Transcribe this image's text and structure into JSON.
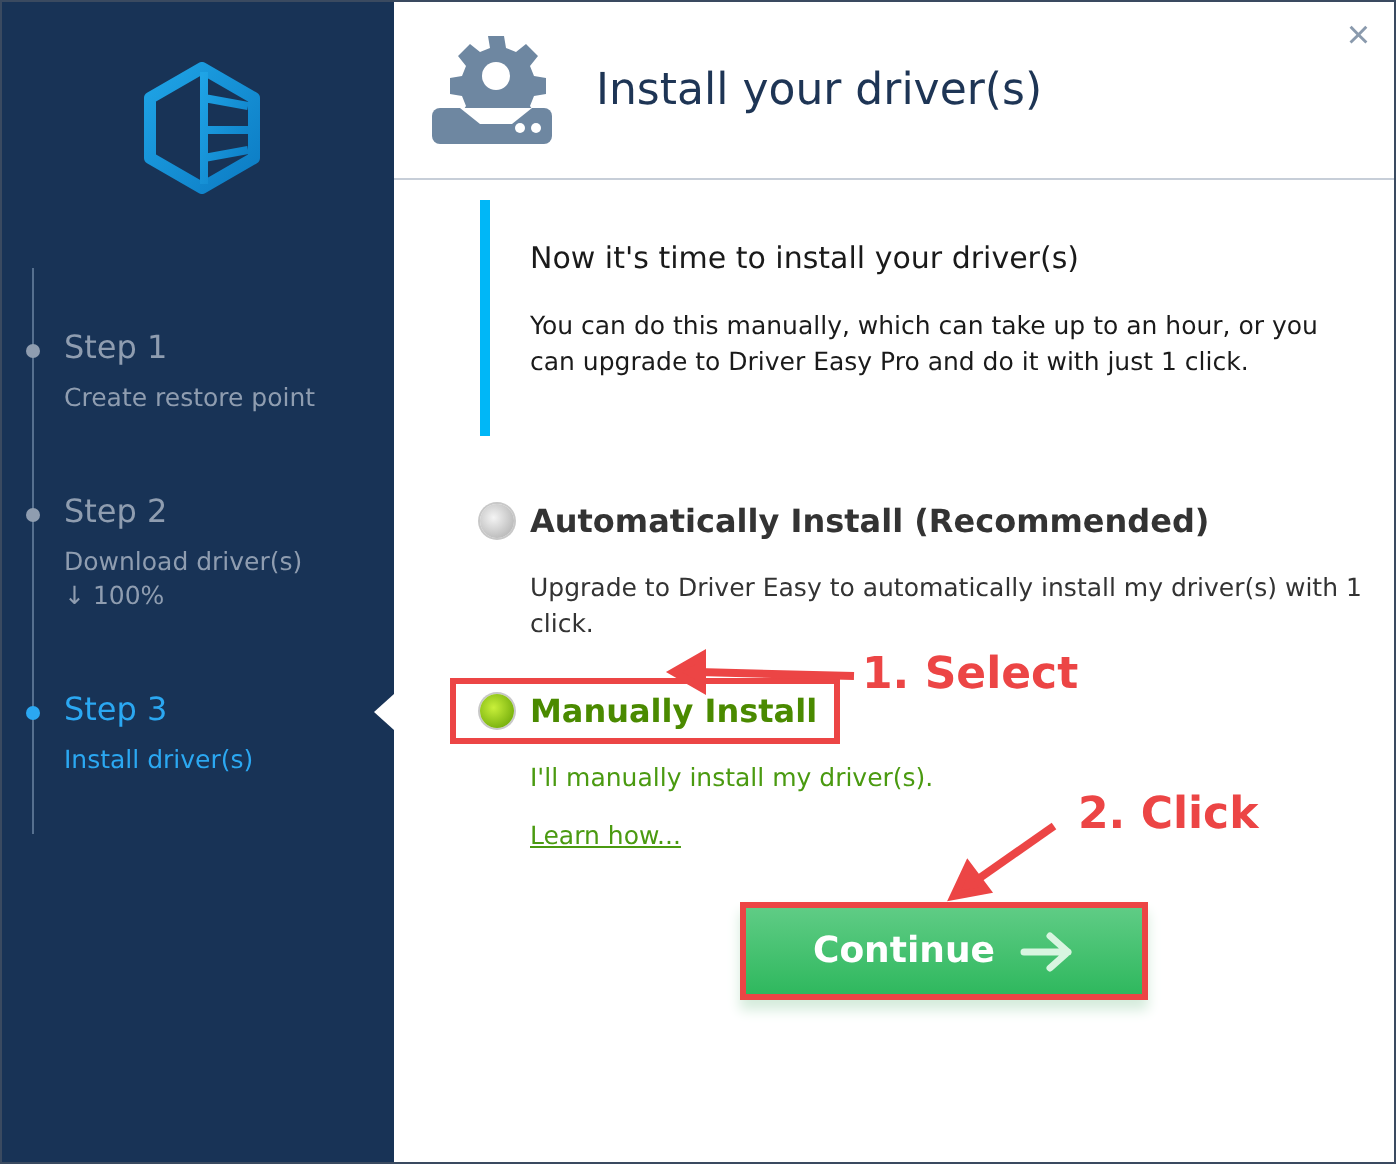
{
  "sidebar": {
    "steps": [
      {
        "title": "Step 1",
        "subtitle": "Create restore point",
        "selected": false
      },
      {
        "title": "Step 2",
        "subtitle": "Download driver(s)",
        "progress": "↓ 100%",
        "selected": false
      },
      {
        "title": "Step 3",
        "subtitle": "Install driver(s)",
        "selected": true
      }
    ]
  },
  "header": {
    "title": "Install your driver(s)",
    "close": "×"
  },
  "info": {
    "heading": "Now it's time to install your driver(s)",
    "body": "You can do this manually, which can take up to an hour, or you can upgrade to Driver Easy Pro and do it with just 1 click."
  },
  "options": [
    {
      "label": "Automatically Install (Recommended)",
      "description": "Upgrade to Driver Easy to automatically install my driver(s) with 1 click.",
      "selected": false,
      "highlighted": false
    },
    {
      "label": "Manually Install",
      "description": "I'll manually install my driver(s).",
      "link": "Learn how...",
      "selected": true,
      "highlighted": true
    }
  ],
  "continue_button": {
    "label": "Continue",
    "highlighted": true
  },
  "annotations": [
    {
      "text": "1. Select"
    },
    {
      "text": "2. Click"
    }
  ]
}
